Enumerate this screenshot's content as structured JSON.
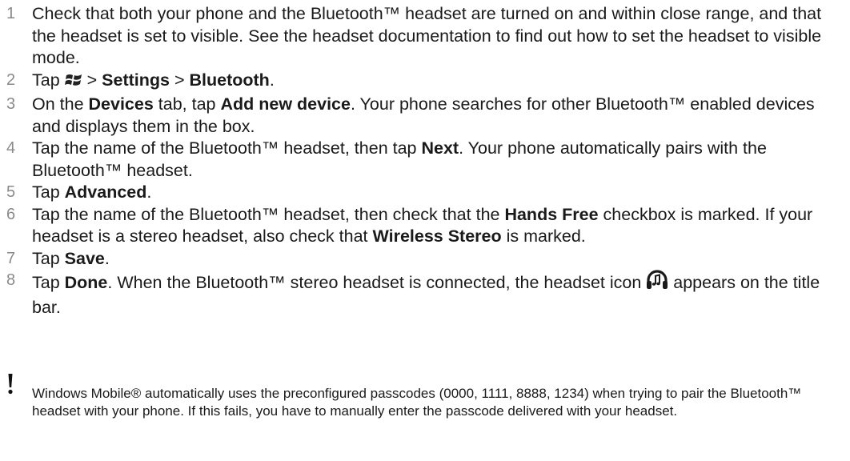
{
  "steps": [
    {
      "number": "1",
      "parts": [
        {
          "text": "Check that both your phone and the Bluetooth™ headset are turned on and within close range, and that the headset is set to visible. See the headset documentation to find out how to set the headset to visible mode.",
          "bold": false
        }
      ]
    },
    {
      "number": "2",
      "parts": [
        {
          "text": "Tap ",
          "bold": false
        },
        {
          "icon": "windows-start-icon"
        },
        {
          "text": " > ",
          "bold": false
        },
        {
          "text": "Settings",
          "bold": true
        },
        {
          "text": " > ",
          "bold": false
        },
        {
          "text": "Bluetooth",
          "bold": true
        },
        {
          "text": ".",
          "bold": false
        }
      ]
    },
    {
      "number": "3",
      "parts": [
        {
          "text": "On the ",
          "bold": false
        },
        {
          "text": "Devices",
          "bold": true
        },
        {
          "text": " tab, tap ",
          "bold": false
        },
        {
          "text": "Add new device",
          "bold": true
        },
        {
          "text": ". Your phone searches for other Bluetooth™ enabled devices and displays them in the box.",
          "bold": false
        }
      ]
    },
    {
      "number": "4",
      "parts": [
        {
          "text": "Tap the name of the Bluetooth™ headset, then tap ",
          "bold": false
        },
        {
          "text": "Next",
          "bold": true
        },
        {
          "text": ". Your phone automatically pairs with the Bluetooth™ headset.",
          "bold": false
        }
      ]
    },
    {
      "number": "5",
      "parts": [
        {
          "text": "Tap ",
          "bold": false
        },
        {
          "text": "Advanced",
          "bold": true
        },
        {
          "text": ".",
          "bold": false
        }
      ]
    },
    {
      "number": "6",
      "parts": [
        {
          "text": "Tap the name of the Bluetooth™ headset, then check that the ",
          "bold": false
        },
        {
          "text": "Hands Free",
          "bold": true
        },
        {
          "text": " checkbox is marked. If your headset is a stereo headset, also check that ",
          "bold": false
        },
        {
          "text": "Wireless Stereo",
          "bold": true
        },
        {
          "text": " is marked.",
          "bold": false
        }
      ]
    },
    {
      "number": "7",
      "parts": [
        {
          "text": "Tap ",
          "bold": false
        },
        {
          "text": "Save",
          "bold": true
        },
        {
          "text": ".",
          "bold": false
        }
      ]
    },
    {
      "number": "8",
      "parts": [
        {
          "text": "Tap ",
          "bold": false
        },
        {
          "text": "Done",
          "bold": true
        },
        {
          "text": ". When the Bluetooth™ stereo headset is connected, the headset icon ",
          "bold": false
        },
        {
          "icon": "headset-icon"
        },
        {
          "text": " appears on the title bar.",
          "bold": false
        }
      ]
    }
  ],
  "note": {
    "icon": "exclamation-icon",
    "text": "Windows Mobile® automatically uses the preconfigured passcodes (0000, 1111, 8888, 1234) when trying to pair the Bluetooth™ headset with your phone. If this fails, you have to manually enter the passcode delivered with your headset."
  }
}
